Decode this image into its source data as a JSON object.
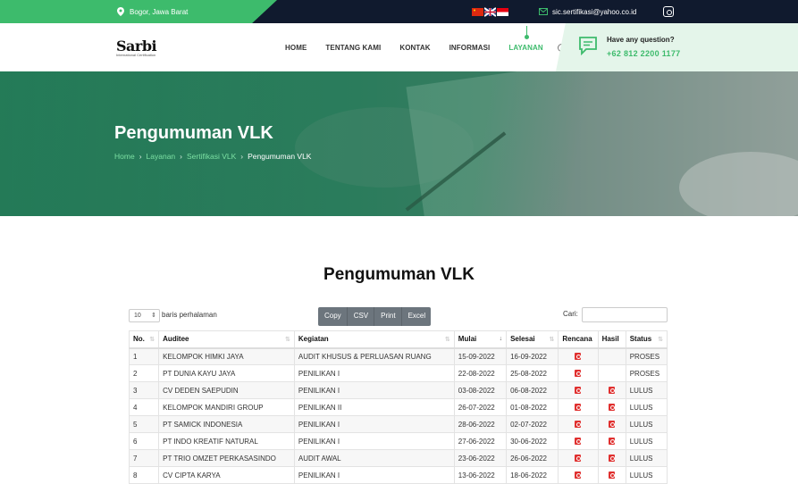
{
  "topbar": {
    "location": "Bogor, Jawa Barat",
    "email": "sic.sertifikasi@yahoo.co.id",
    "flags": [
      "china-flag",
      "uk-flag",
      "indonesia-flag"
    ],
    "social_icon": "instagram-icon"
  },
  "header": {
    "logo_brand": "Sarbi",
    "logo_tagline": "International Certification",
    "nav": [
      {
        "label": "HOME",
        "active": false
      },
      {
        "label": "TENTANG KAMI",
        "active": false
      },
      {
        "label": "KONTAK",
        "active": false
      },
      {
        "label": "INFORMASI",
        "active": false
      },
      {
        "label": "LAYANAN",
        "active": true
      }
    ],
    "question_label": "Have any question?",
    "phone": "+62 812 2200 1177"
  },
  "hero": {
    "title": "Pengumuman VLK",
    "breadcrumb": [
      "Home",
      "Layanan",
      "Sertifikasi VLK",
      "Pengumuman VLK"
    ]
  },
  "main": {
    "title": "Pengumuman VLK",
    "page_length": "10",
    "page_length_label": "baris perhalaman",
    "export_buttons": [
      "Copy",
      "CSV",
      "Print",
      "Excel"
    ],
    "search_label": "Cari:",
    "search_value": ""
  },
  "table": {
    "columns": [
      "No.",
      "Auditee",
      "Kegiatan",
      "Mulai",
      "Selesai",
      "Rencana",
      "Hasil",
      "Status"
    ],
    "rows": [
      {
        "no": "1",
        "auditee": "KELOMPOK HIMKI JAYA",
        "kegiatan": "AUDIT KHUSUS & PERLUASAN RUANG",
        "mulai": "15-09-2022",
        "selesai": "16-09-2022",
        "rencana": true,
        "hasil": false,
        "status": "PROSES"
      },
      {
        "no": "2",
        "auditee": "PT DUNIA KAYU JAYA",
        "kegiatan": "PENILIKAN I",
        "mulai": "22-08-2022",
        "selesai": "25-08-2022",
        "rencana": true,
        "hasil": false,
        "status": "PROSES"
      },
      {
        "no": "3",
        "auditee": "CV DEDEN SAEPUDIN",
        "kegiatan": "PENILIKAN I",
        "mulai": "03-08-2022",
        "selesai": "06-08-2022",
        "rencana": true,
        "hasil": true,
        "status": "LULUS"
      },
      {
        "no": "4",
        "auditee": "KELOMPOK MANDIRI GROUP",
        "kegiatan": "PENILIKAN II",
        "mulai": "26-07-2022",
        "selesai": "01-08-2022",
        "rencana": true,
        "hasil": true,
        "status": "LULUS"
      },
      {
        "no": "5",
        "auditee": "PT SAMICK INDONESIA",
        "kegiatan": "PENILIKAN I",
        "mulai": "28-06-2022",
        "selesai": "02-07-2022",
        "rencana": true,
        "hasil": true,
        "status": "LULUS"
      },
      {
        "no": "6",
        "auditee": "PT INDO KREATIF NATURAL",
        "kegiatan": "PENILIKAN I",
        "mulai": "27-06-2022",
        "selesai": "30-06-2022",
        "rencana": true,
        "hasil": true,
        "status": "LULUS"
      },
      {
        "no": "7",
        "auditee": "PT TRIO OMZET PERKASASINDO",
        "kegiatan": "AUDIT AWAL",
        "mulai": "23-06-2022",
        "selesai": "26-06-2022",
        "rencana": true,
        "hasil": true,
        "status": "LULUS"
      },
      {
        "no": "8",
        "auditee": "CV CIPTA KARYA",
        "kegiatan": "PENILIKAN I",
        "mulai": "13-06-2022",
        "selesai": "18-06-2022",
        "rencana": true,
        "hasil": true,
        "status": "LULUS"
      }
    ]
  },
  "colors": {
    "accent": "#3dbb6c",
    "topbar": "#101a2e",
    "pdf_icon": "#e0302f",
    "button": "#6c757d"
  }
}
